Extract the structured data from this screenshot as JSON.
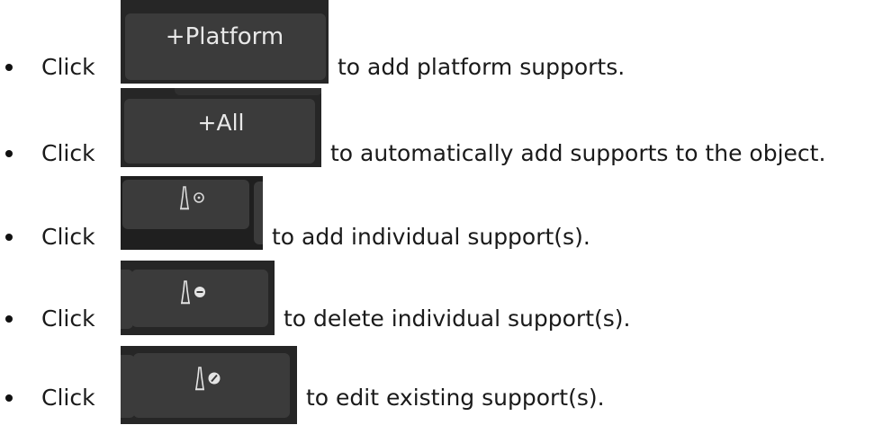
{
  "items": [
    {
      "click_word": "Click",
      "button_label": "+Platform",
      "description": "to add platform supports."
    },
    {
      "click_word": "Click",
      "button_label": "+All",
      "description": "to automatically add supports to the object."
    },
    {
      "click_word": "Click",
      "button_icon": "support-add-icon",
      "description": "to add individual support(s)."
    },
    {
      "click_word": "Click",
      "button_icon": "support-delete-icon",
      "description": "to delete individual support(s)."
    },
    {
      "click_word": "Click",
      "button_icon": "support-edit-icon",
      "description": "to edit existing support(s)."
    }
  ]
}
